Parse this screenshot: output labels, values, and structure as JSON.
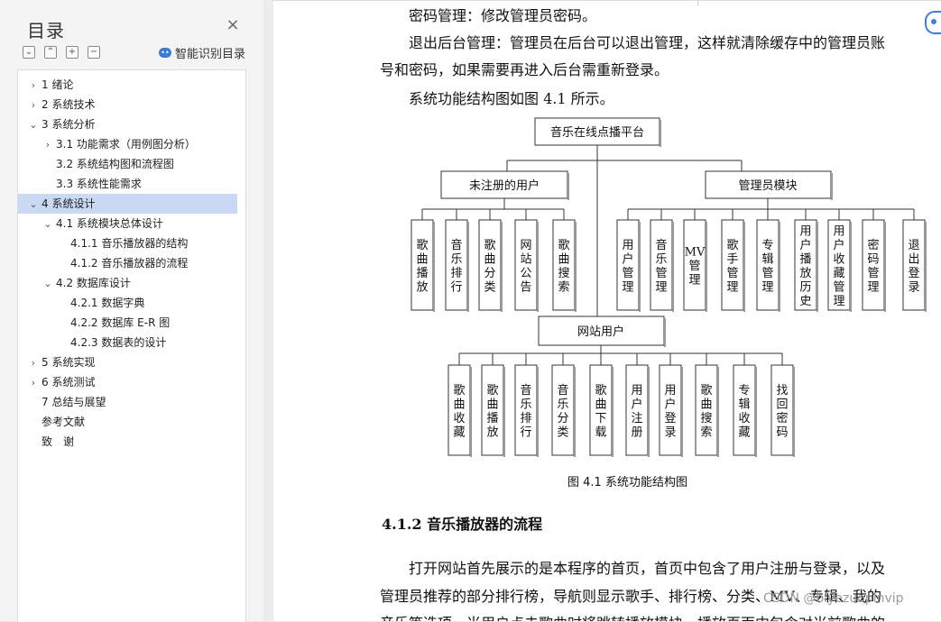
{
  "sidebar": {
    "title": "目录",
    "close_icon": "close-icon",
    "tools": [
      {
        "name": "collapse-all-icon",
        "glyph": "⌄"
      },
      {
        "name": "expand-up-icon",
        "glyph": "⌃"
      },
      {
        "name": "add-heading-icon",
        "glyph": "+"
      },
      {
        "name": "remove-heading-icon",
        "glyph": "−"
      }
    ],
    "smart_label": "智能识别目录",
    "toc": [
      {
        "label": "1 绪论",
        "level": 0,
        "arrow": "›"
      },
      {
        "label": "2 系统技术",
        "level": 0,
        "arrow": "›"
      },
      {
        "label": "3 系统分析",
        "level": 0,
        "arrow": "⌄"
      },
      {
        "label": "3.1  功能需求（用例图分析）",
        "level": 1,
        "arrow": "›"
      },
      {
        "label": "3.2  系统结构图和流程图",
        "level": 1,
        "arrow": ""
      },
      {
        "label": "3.3  系统性能需求",
        "level": 1,
        "arrow": ""
      },
      {
        "label": "4 系统设计",
        "level": 0,
        "arrow": "⌄",
        "selected": true
      },
      {
        "label": "4.1  系统模块总体设计",
        "level": 1,
        "arrow": "⌄"
      },
      {
        "label": "4.1.1  音乐播放器的结构",
        "level": 2,
        "arrow": ""
      },
      {
        "label": "4.1.2  音乐播放器的流程",
        "level": 2,
        "arrow": ""
      },
      {
        "label": "4.2  数据库设计",
        "level": 1,
        "arrow": "⌄"
      },
      {
        "label": "4.2.1  数据字典",
        "level": 2,
        "arrow": ""
      },
      {
        "label": "4.2.2  数据库 E-R 图",
        "level": 2,
        "arrow": ""
      },
      {
        "label": "4.2.3  数据表的设计",
        "level": 2,
        "arrow": ""
      },
      {
        "label": "5 系统实现",
        "level": 0,
        "arrow": "›"
      },
      {
        "label": "6 系统测试",
        "level": 0,
        "arrow": "›"
      },
      {
        "label": "7 总结与展望",
        "level": 0,
        "arrow": ""
      },
      {
        "label": "参考文献",
        "level": 0,
        "arrow": ""
      },
      {
        "label": "致　谢",
        "level": 0,
        "arrow": ""
      }
    ]
  },
  "document": {
    "lines": [
      "密码管理：修改管理员密码。",
      "退出后台管理：管理员在后台可以退出管理，这样就清除缓存中的管理员账",
      "号和密码，如果需要再进入后台需重新登录。",
      "系统功能结构图如图 4.1 所示。"
    ],
    "figure": {
      "root": "音乐在线点播平台",
      "unregistered": "未注册的用户",
      "admin": "管理员模块",
      "site_user": "网站用户",
      "unreg_leaves": [
        "歌曲播放",
        "音乐排行",
        "歌曲分类",
        "网站公告",
        "歌曲搜索"
      ],
      "admin_leaves": [
        "用户管理",
        "音乐管理",
        "MV管理",
        "歌手管理",
        "专辑管理",
        "用户播放历史",
        "用户收藏管理",
        "密码管理",
        "退出登录"
      ],
      "user_leaves": [
        "歌曲收藏",
        "歌曲播放",
        "音乐排行",
        "音乐分类",
        "歌曲下载",
        "用户注册",
        "用户登录",
        "歌曲搜索",
        "专辑收藏",
        "找回密码"
      ],
      "caption": "图 4.1  系统功能结构图"
    },
    "heading": "4.1.2  音乐播放器的流程",
    "para": [
      "打开网站首先展示的是本程序的首页，首页中包含了用户注册与登录，以及",
      "管理员推荐的部分排行榜，导航则显示歌手、排行榜、分类、MV、专辑、我的",
      "音乐等选项，当用户点击歌曲时将跳转播放模块，播放页面中包含对当前歌曲的"
    ],
    "watermark": "CSDN @biyezuopinvip"
  }
}
